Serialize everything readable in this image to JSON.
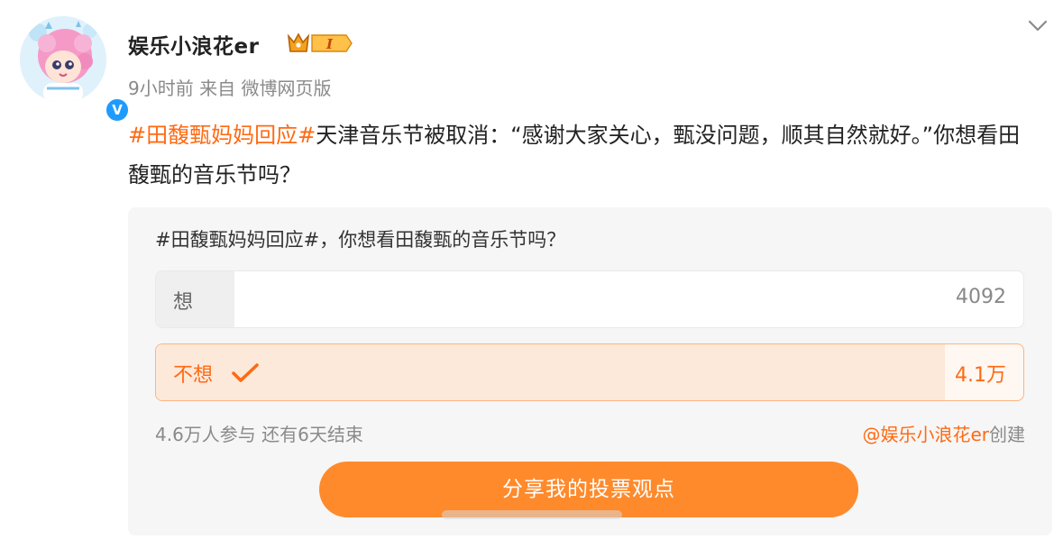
{
  "user": {
    "name": "娱乐小浪花er",
    "vip_level": "I",
    "verified_mark": "V",
    "time": "9小时前",
    "source": "来自 微博网页版"
  },
  "post": {
    "topic": "#田馥甄妈妈回应#",
    "text": "天津音乐节被取消：“感谢大家关心，甄没问题，顺其自然就好。”你想看田馥甄的音乐节吗？"
  },
  "vote": {
    "title": "#田馥甄妈妈回应#，你想看田馥甄的音乐节吗？",
    "options": [
      {
        "label": "想",
        "count": "4092",
        "share": 0.09,
        "selected": false
      },
      {
        "label": "不想",
        "count": "4.1万",
        "share": 0.91,
        "selected": true
      }
    ],
    "participants": "4.6万人参与",
    "remaining": "还有6天结束",
    "creator": "@娱乐小浪花er",
    "created_suffix": "创建",
    "share_button": "分享我的投票观点"
  },
  "icons": {
    "chevron": "chevron-down-icon",
    "verified": "verified-badge-icon",
    "check": "check-icon",
    "vip": "crown-vip-icon"
  },
  "colors": {
    "accent": "#ff6a13",
    "button": "#ff8a2b",
    "verified": "#1e9bff"
  }
}
